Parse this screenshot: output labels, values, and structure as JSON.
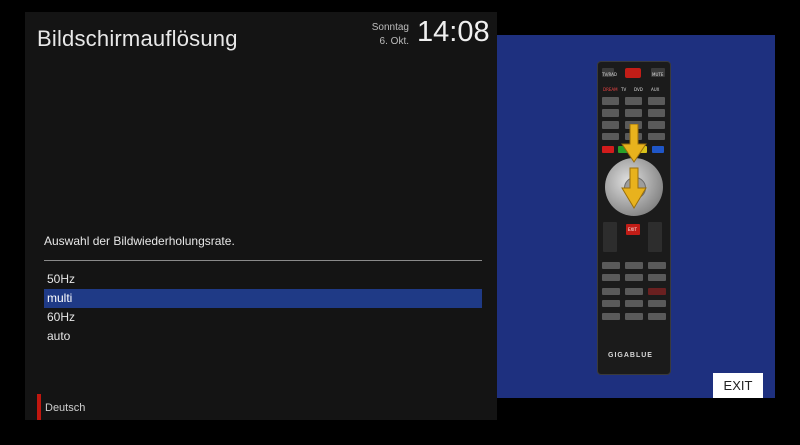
{
  "header": {
    "title": "Bildschirmauflösung",
    "weekday": "Sonntag",
    "date": "6. Okt.",
    "time": "14:08"
  },
  "setting": {
    "description": "Auswahl der Bildwiederholungsrate.",
    "options": [
      "50Hz",
      "multi",
      "60Hz",
      "auto"
    ],
    "selected": "multi"
  },
  "footer": {
    "language_label": "Deutsch",
    "language_color": "#c0170f"
  },
  "help": {
    "exit_label": "EXIT",
    "remote": {
      "brand": "GIGABLUE",
      "top_labels": [
        "TV/RAD",
        "MUTE"
      ],
      "source_labels": [
        "DREAM",
        "TV",
        "DVD",
        "AUX"
      ],
      "exit_key_label": "EXIT",
      "accent_color": "#1e307f"
    }
  },
  "colors": {
    "selection": "#1f3a86",
    "help_panel": "#1e307f",
    "red_key": "#c21d17"
  }
}
